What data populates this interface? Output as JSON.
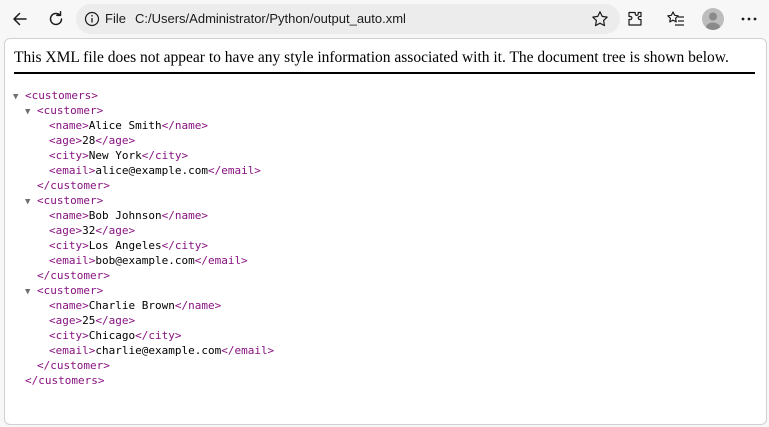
{
  "browser": {
    "address": {
      "scheme_label": "File",
      "url": "C:/Users/Administrator/Python/output_auto.xml"
    }
  },
  "page": {
    "header_message": "This XML file does not appear to have any style information associated with it. The document tree is shown below.",
    "root_tag": "customers",
    "customers": [
      {
        "name": "Alice Smith",
        "age": "28",
        "city": "New York",
        "email": "alice@example.com"
      },
      {
        "name": "Bob Johnson",
        "age": "32",
        "city": "Los Angeles",
        "email": "bob@example.com"
      },
      {
        "name": "Charlie Brown",
        "age": "25",
        "city": "Chicago",
        "email": "charlie@example.com"
      }
    ],
    "item_tag": "customer",
    "field_tags": [
      "name",
      "age",
      "city",
      "email"
    ]
  },
  "colors": {
    "tag": "#881280",
    "toggle": "#6e6e6e"
  }
}
